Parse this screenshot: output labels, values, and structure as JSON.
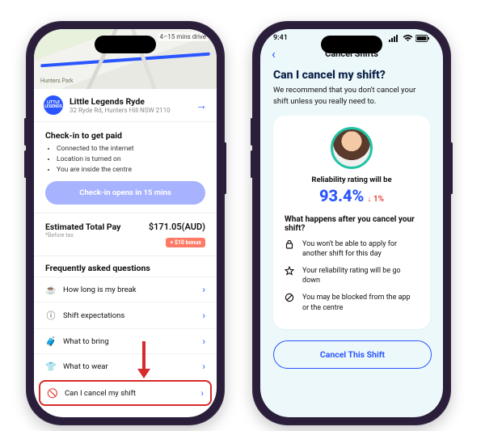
{
  "phone1": {
    "drive_eta": "4–15 mins drive",
    "park_label": "Hunters Park",
    "place": {
      "logo_text": "LITTLE LEGENDS",
      "name": "Little Legends Ryde",
      "address": "32 Ryde Rd, Hunters Hill NSW 2110"
    },
    "checkin": {
      "title": "Check-in to get paid",
      "bullets": [
        "Connected to the internet",
        "Location is turned on",
        "You are inside the centre"
      ],
      "button": "Check-in opens in 15 mins"
    },
    "pay": {
      "label": "Estimated Total Pay",
      "note": "*Before tax",
      "amount": "$171.05(AUD)",
      "bonus": "+ $10 bonus"
    },
    "faq_title": "Frequently asked questions",
    "faq": [
      {
        "icon": "☕",
        "label": "How long is my break"
      },
      {
        "icon": "ⓘ",
        "label": "Shift expectations"
      },
      {
        "icon": "🧳",
        "label": "What to bring"
      },
      {
        "icon": "👕",
        "label": "What to wear"
      },
      {
        "icon": "🚫",
        "label": "Can I cancel my shift"
      }
    ]
  },
  "phone2": {
    "time": "9:41",
    "nav_title": "Cancel Shifts",
    "question": "Can I cancel my shift?",
    "subtext": "We recommend that you don't cancel your shift unless you really need to.",
    "rating_label": "Reliability rating will be",
    "rating_value": "93.4%",
    "rating_delta": "↓ 1%",
    "what_title": "What happens after you cancel your shift?",
    "consequences": [
      {
        "icon": "lock",
        "text": "You won't be able to apply for another shift for this day"
      },
      {
        "icon": "star",
        "text": "Your reliability rating will be go down"
      },
      {
        "icon": "ban",
        "text": "You may be blocked from the app or the centre"
      }
    ],
    "cancel_button": "Cancel This Shift"
  }
}
